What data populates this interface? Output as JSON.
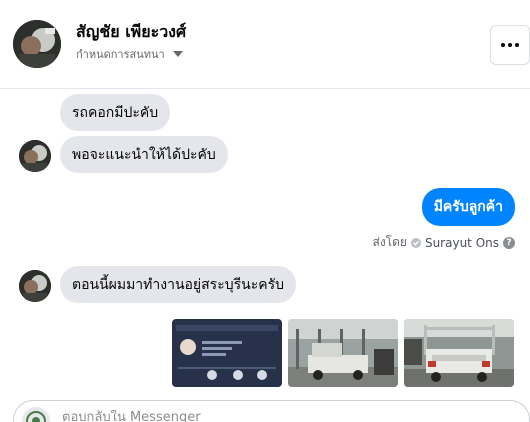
{
  "header": {
    "contact_name": "สัญชัย เพียะวงศ์",
    "subtitle": "กำหนดการสนทนา",
    "more_icon": "more-dots-icon"
  },
  "messages": [
    {
      "direction": "incoming",
      "text": "รถคอกมีปะคับ"
    },
    {
      "direction": "incoming",
      "text": "พอจะแนะนำให้ได้ปะคับ"
    },
    {
      "direction": "outgoing",
      "text": "มีครับลูกค้า"
    },
    {
      "direction": "incoming",
      "text": "ตอนนี้ผมมาทำงานอยู่สระบุรีนะครับ"
    }
  ],
  "sent_by": {
    "prefix": "ส่งโดย",
    "sender": "Surayut Ons"
  },
  "composer": {
    "placeholder": "ตอบกลับใน Messenger"
  },
  "colors": {
    "outgoing_bubble": "#0084ff",
    "incoming_bubble": "#e4e6eb",
    "secondary_text": "#65676b"
  }
}
